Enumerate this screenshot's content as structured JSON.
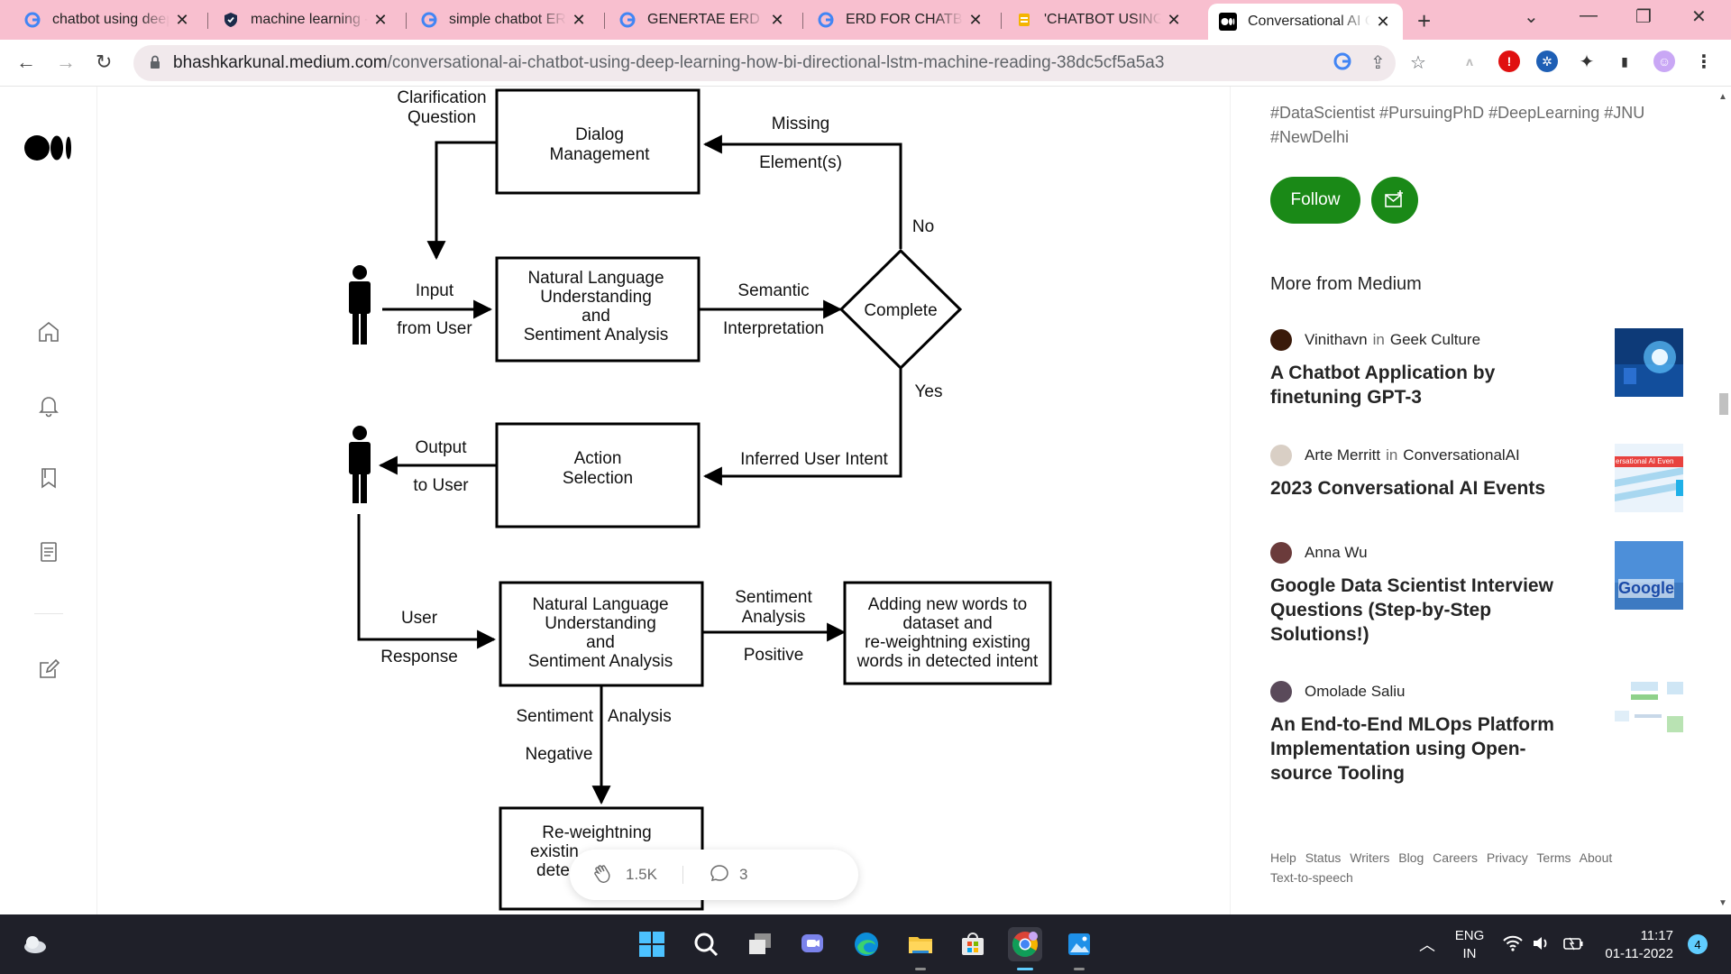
{
  "browser": {
    "tabs": [
      {
        "title": "chatbot using deep learning - Google Search",
        "icon": "google-icon",
        "active": false
      },
      {
        "title": "machine learning - Is it possible",
        "icon": "shield-icon",
        "active": false
      },
      {
        "title": "simple chatbot ERD - Google Search",
        "icon": "google-icon",
        "active": false
      },
      {
        "title": "GENERTAE ERD DIAGRAM - Google",
        "icon": "google-icon",
        "active": false
      },
      {
        "title": "ERD FOR CHATBOT - Google Search",
        "icon": "google-icon",
        "active": false
      },
      {
        "title": "'CHATBOT USING DEEP LEARNING'",
        "icon": "doc-icon",
        "active": false
      },
      {
        "title": "Conversational AI Chatbot",
        "icon": "medium-icon",
        "active": true
      }
    ],
    "new_tab": "+",
    "url_host": "bhashkarkunal.medium.com",
    "url_path": "/conversational-ai-chatbot-using-deep-learning-how-bi-directional-lstm-machine-reading-38dc5cf5a5a3"
  },
  "diagram": {
    "clarification_question": [
      "Clarification",
      "Question"
    ],
    "dialog_management": [
      "Dialog",
      "Management"
    ],
    "missing": "Missing",
    "elements": "Element(s)",
    "no": "No",
    "input": "Input",
    "from_user": "from User",
    "nlu_box": [
      "Natural Language",
      "Understanding",
      "and",
      "Sentiment Analysis"
    ],
    "semantic": "Semantic",
    "interpretation": "Interpretation",
    "complete": "Complete",
    "yes": "Yes",
    "output": "Output",
    "to_user": "to User",
    "action_selection": [
      "Action",
      "Selection"
    ],
    "inferred_intent": "Inferred User Intent",
    "user": "User",
    "response": "Response",
    "nlu_box2": [
      "Natural Language",
      "Understanding",
      "and",
      "Sentiment Analysis"
    ],
    "sentiment_analysis": [
      "Sentiment",
      "Analysis"
    ],
    "positive": "Positive",
    "adding_words": [
      "Adding new words to",
      "dataset and",
      "re-weightning existing",
      "words in detected intent"
    ],
    "sentiment": "Sentiment",
    "analysis": "Analysis",
    "negative": "Negative",
    "reweight": [
      "Re-weightning",
      "existin",
      "dete"
    ]
  },
  "engagement": {
    "claps": "1.5K",
    "responses": "3"
  },
  "sidebar": {
    "tags": "#DataScientist #PursuingPhD #DeepLearning #JNU #NewDelhi",
    "follow_label": "Follow",
    "more_heading": "More from Medium",
    "stories": [
      {
        "author": "Vinithavn",
        "in": "in",
        "publication": "Geek Culture",
        "title": "A Chatbot Application by finetuning GPT-3"
      },
      {
        "author": "Arte Merritt",
        "in": "in",
        "publication": "ConversationalAI",
        "title": "2023 Conversational AI Events"
      },
      {
        "author": "Anna Wu",
        "in": "",
        "publication": "",
        "title": "Google Data Scientist Interview Questions (Step-by-Step Solutions!)"
      },
      {
        "author": "Omolade Saliu",
        "in": "",
        "publication": "",
        "title": "An End-to-End MLOps Platform Implementation using Open-source Tooling"
      }
    ],
    "thumb2_text": "ersational AI Even",
    "thumb3_text": "Google",
    "footer": [
      "Help",
      "Status",
      "Writers",
      "Blog",
      "Careers",
      "Privacy",
      "Terms",
      "About",
      "Text-to-speech"
    ]
  },
  "taskbar": {
    "lang": "ENG",
    "region": "IN",
    "time": "11:17",
    "date": "01-11-2022",
    "notifications": "4"
  },
  "colors": {
    "tab_strip": "#f8bfcf",
    "medium_green": "#1a8917",
    "taskbar": "#1f2029"
  }
}
